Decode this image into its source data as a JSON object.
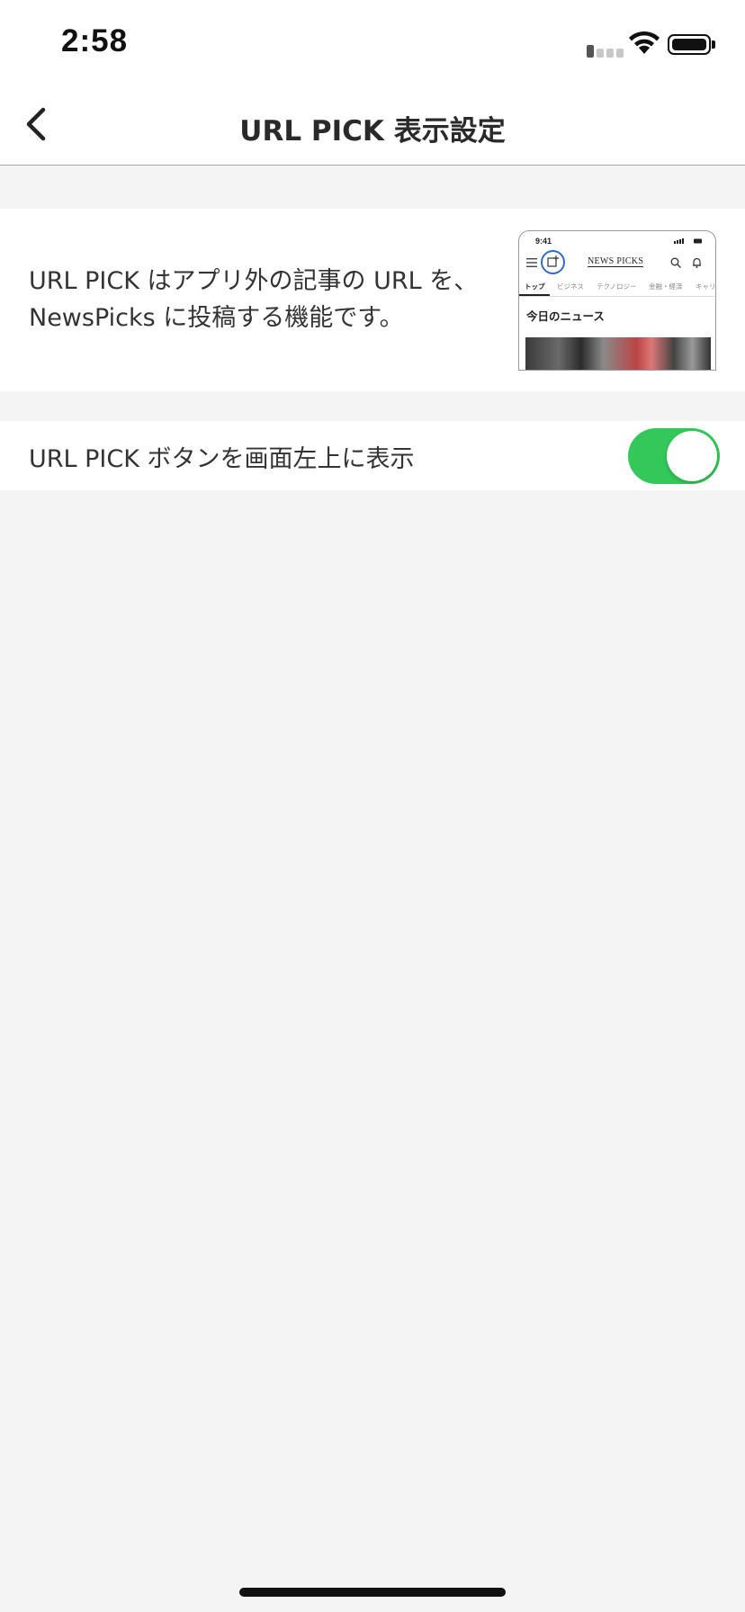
{
  "status_bar": {
    "time": "2:58"
  },
  "nav": {
    "title": "URL PICK 表示設定",
    "back_icon": "chevron-left-icon"
  },
  "info": {
    "line1": "URL PICK はアプリ外の記事の URL を、",
    "line2": "NewsPicks に投稿する機能です。"
  },
  "preview": {
    "time": "9:41",
    "logo": "NEWS PICKS",
    "tabs": [
      "トップ",
      "ビジネス",
      "テクノロジー",
      "金融・経済",
      "キャリ"
    ],
    "headline": "今日のニュース"
  },
  "setting": {
    "label": "URL PICK ボタンを画面左上に表示",
    "enabled": true,
    "toggle_color": "#34c759"
  }
}
